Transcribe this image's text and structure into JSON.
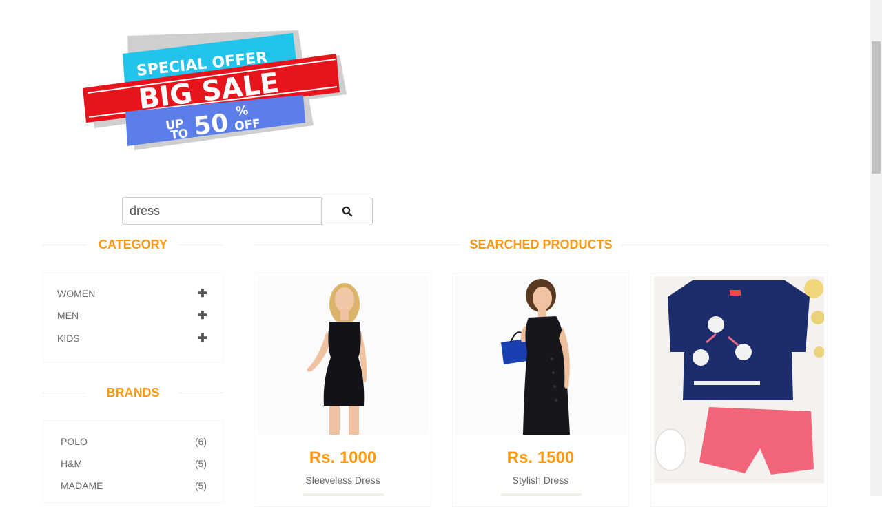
{
  "banner": {
    "line1": "SPECIAL OFFER",
    "line2": "BIG SALE",
    "up": "UP",
    "to": "TO",
    "percent_value": "50",
    "percent_sign": "%",
    "off": "OFF"
  },
  "search": {
    "value": "dress",
    "button_icon": "search-icon"
  },
  "category": {
    "title": "CATEGORY",
    "items": [
      {
        "label": "WOMEN",
        "icon": "plus-icon"
      },
      {
        "label": "MEN",
        "icon": "plus-icon"
      },
      {
        "label": "KIDS",
        "icon": "plus-icon"
      }
    ]
  },
  "brands": {
    "title": "BRANDS",
    "items": [
      {
        "label": "POLO",
        "count": "(6)"
      },
      {
        "label": "H&M",
        "count": "(5)"
      },
      {
        "label": "MADAME",
        "count": "(5)"
      }
    ]
  },
  "products": {
    "title": "SEARCHED PRODUCTS",
    "items": [
      {
        "price": "Rs. 1000",
        "name": "Sleeveless Dress"
      },
      {
        "price": "Rs. 1500",
        "name": "Stylish Dress"
      },
      {
        "price": "",
        "name": ""
      }
    ]
  },
  "colors": {
    "accent": "#fe980f",
    "banner_cyan": "#23c4ec",
    "banner_red": "#e8141c",
    "banner_blue": "#5b7ee8"
  }
}
